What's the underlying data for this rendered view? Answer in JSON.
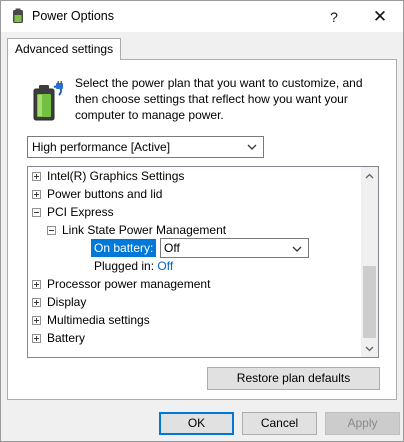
{
  "window": {
    "title": "Power Options",
    "help_glyph": "?",
    "close_glyph": "✕"
  },
  "tab": {
    "label": "Advanced settings"
  },
  "intro": {
    "text": "Select the power plan that you want to customize, and then choose settings that reflect how you want your computer to manage power."
  },
  "plan_select": {
    "value": "High performance [Active]"
  },
  "tree": {
    "items": [
      {
        "label": "Intel(R) Graphics Settings",
        "expanded": false
      },
      {
        "label": "Power buttons and lid",
        "expanded": false
      },
      {
        "label": "PCI Express",
        "expanded": true
      },
      {
        "label": "Link State Power Management",
        "expanded": true
      },
      {
        "label": "On battery:",
        "value": "Off"
      },
      {
        "label": "Plugged in:",
        "value": "Off"
      },
      {
        "label": "Processor power management",
        "expanded": false
      },
      {
        "label": "Display",
        "expanded": false
      },
      {
        "label": "Multimedia settings",
        "expanded": false
      },
      {
        "label": "Battery",
        "expanded": false
      }
    ]
  },
  "buttons": {
    "restore": "Restore plan defaults",
    "ok": "OK",
    "cancel": "Cancel",
    "apply": "Apply"
  },
  "colors": {
    "selection": "#0078d7",
    "link": "#0066cc",
    "window_bg": "#f0f0f0"
  },
  "icons": {
    "title": "power-options-icon",
    "battery": "battery-plug-icon"
  }
}
